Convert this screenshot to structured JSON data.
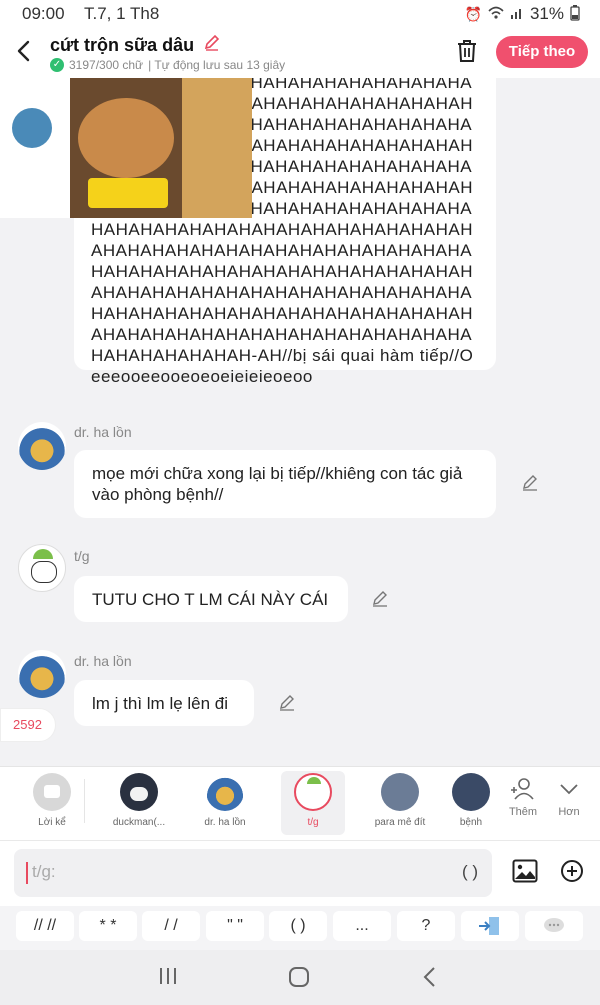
{
  "status": {
    "time": "09:00",
    "date": "T.7, 1 Th8",
    "battery": "31%"
  },
  "header": {
    "title": "cứt trộn sữa dâu",
    "count_text": "3197/300 chữ",
    "autosave_text": "| Tự động lưu sau 13 giây",
    "next_label": "Tiếp theo"
  },
  "messages": [
    {
      "speaker": "",
      "text": "AHAHAHAHAHAHAHAHAHAHAHAHAHAHAHAHAHAHAHAHAHAHAHAHAHAHAHAHAHAHAHAHAHAHAHAHAHAHAHAHAHAHAHAHAHAHAHAHAHAHAHAHAHAHAHAHAHAHAHAHAHAHAHAHAHAHAHAHAHAHAHAHAHAHAHAHAHAHAHAHAHAHAHAHAHAHAHAHAHAHAHAHAHAHAHAHAHAHAHAHAHAHAHAHAHAHAHAHAHAHAHAHAHAHAHAHAHAHAHAHAHAHAHAHAHAHAHAHAHAHAHAHAHAHAHAHAHAHAHAHAHAHAHAHAHAHAHAHAHAHAHAHAHAHAHAHAHAHAHAHAHAHAHAHAHAHAHAHAHAHAHAHAHAHAHAHAHAHAHAHAHAHAHAHAHAHAHAHAHAHAHAHAHAHAHAHAHAHAHAHAHAHAHAHAHAHAHAH-AH//bị sái quai hàm tiếp//Oeeeooeeooeoeoeieieieoeoo"
    },
    {
      "speaker": "dr. ha lồn",
      "text": "mọe mới chữa xong lại bị tiếp//khiêng con tác giả vào phòng bệnh//"
    },
    {
      "speaker": "t/g",
      "text": "TUTU CHO T LM CÁI NÀY CÁI"
    },
    {
      "speaker": "dr. ha lồn",
      "text": "lm j thì lm lẹ lên đi"
    }
  ],
  "count_badge": "2592",
  "characters": [
    {
      "name": "Lời kể",
      "icon": "narration-icon"
    },
    {
      "name": "duckman(...",
      "icon": "avatar"
    },
    {
      "name": "dr. ha lồn",
      "icon": "avatar"
    },
    {
      "name": "t/g",
      "icon": "avatar",
      "active": true
    },
    {
      "name": "para mê đít",
      "icon": "avatar"
    },
    {
      "name": "bệnh",
      "icon": "avatar"
    }
  ],
  "char_actions": {
    "add": "Thêm",
    "more": "Hơn"
  },
  "input": {
    "placeholder": "t/g:",
    "paren": "( )"
  },
  "shortcuts": [
    "// //",
    "* *",
    "/ /",
    "\" \"",
    "( )",
    "...",
    "?"
  ],
  "colors": {
    "accent": "#f0506e",
    "check": "#2fbf71"
  }
}
